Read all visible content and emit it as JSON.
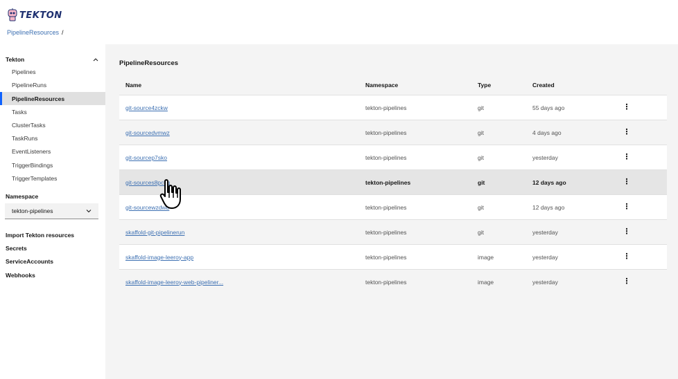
{
  "app": {
    "logo_text": "TEKTON"
  },
  "breadcrumb": {
    "link": "PipelineResources",
    "separator": "/"
  },
  "sidebar": {
    "section_title": "Tekton",
    "items": [
      {
        "label": "Pipelines"
      },
      {
        "label": "PipelineRuns"
      },
      {
        "label": "PipelineResources"
      },
      {
        "label": "Tasks"
      },
      {
        "label": "ClusterTasks"
      },
      {
        "label": "TaskRuns"
      },
      {
        "label": "EventListeners"
      },
      {
        "label": "TriggerBindings"
      },
      {
        "label": "TriggerTemplates"
      }
    ],
    "namespace_label": "Namespace",
    "namespace_value": "tekton-pipelines",
    "links": [
      {
        "label": "Import Tekton resources"
      },
      {
        "label": "Secrets"
      },
      {
        "label": "ServiceAccounts"
      },
      {
        "label": "Webhooks"
      }
    ]
  },
  "main": {
    "title": "PipelineResources",
    "columns": {
      "name": "Name",
      "namespace": "Namespace",
      "type": "Type",
      "created": "Created"
    },
    "rows": [
      {
        "name": "git-source4zckw",
        "namespace": "tekton-pipelines",
        "type": "git",
        "created": "55 days ago"
      },
      {
        "name": "git-sourcedvmwz",
        "namespace": "tekton-pipelines",
        "type": "git",
        "created": "4 days ago"
      },
      {
        "name": "git-sourcep7sko",
        "namespace": "tekton-pipelines",
        "type": "git",
        "created": "yesterday"
      },
      {
        "name": "git-sources8pckg",
        "namespace": "tekton-pipelines",
        "type": "git",
        "created": "12 days ago"
      },
      {
        "name": "git-sourcewzdwb",
        "namespace": "tekton-pipelines",
        "type": "git",
        "created": "12 days ago"
      },
      {
        "name": "skaffold-git-pipelinerun",
        "namespace": "tekton-pipelines",
        "type": "git",
        "created": "yesterday"
      },
      {
        "name": "skaffold-image-leeroy-app",
        "namespace": "tekton-pipelines",
        "type": "image",
        "created": "yesterday"
      },
      {
        "name": "skaffold-image-leeroy-web-pipeliner...",
        "namespace": "tekton-pipelines",
        "type": "image",
        "created": "yesterday"
      }
    ]
  },
  "colors": {
    "accent": "#0f62fe",
    "link": "#3d70b2",
    "hover_row": "#e5e5e5"
  }
}
